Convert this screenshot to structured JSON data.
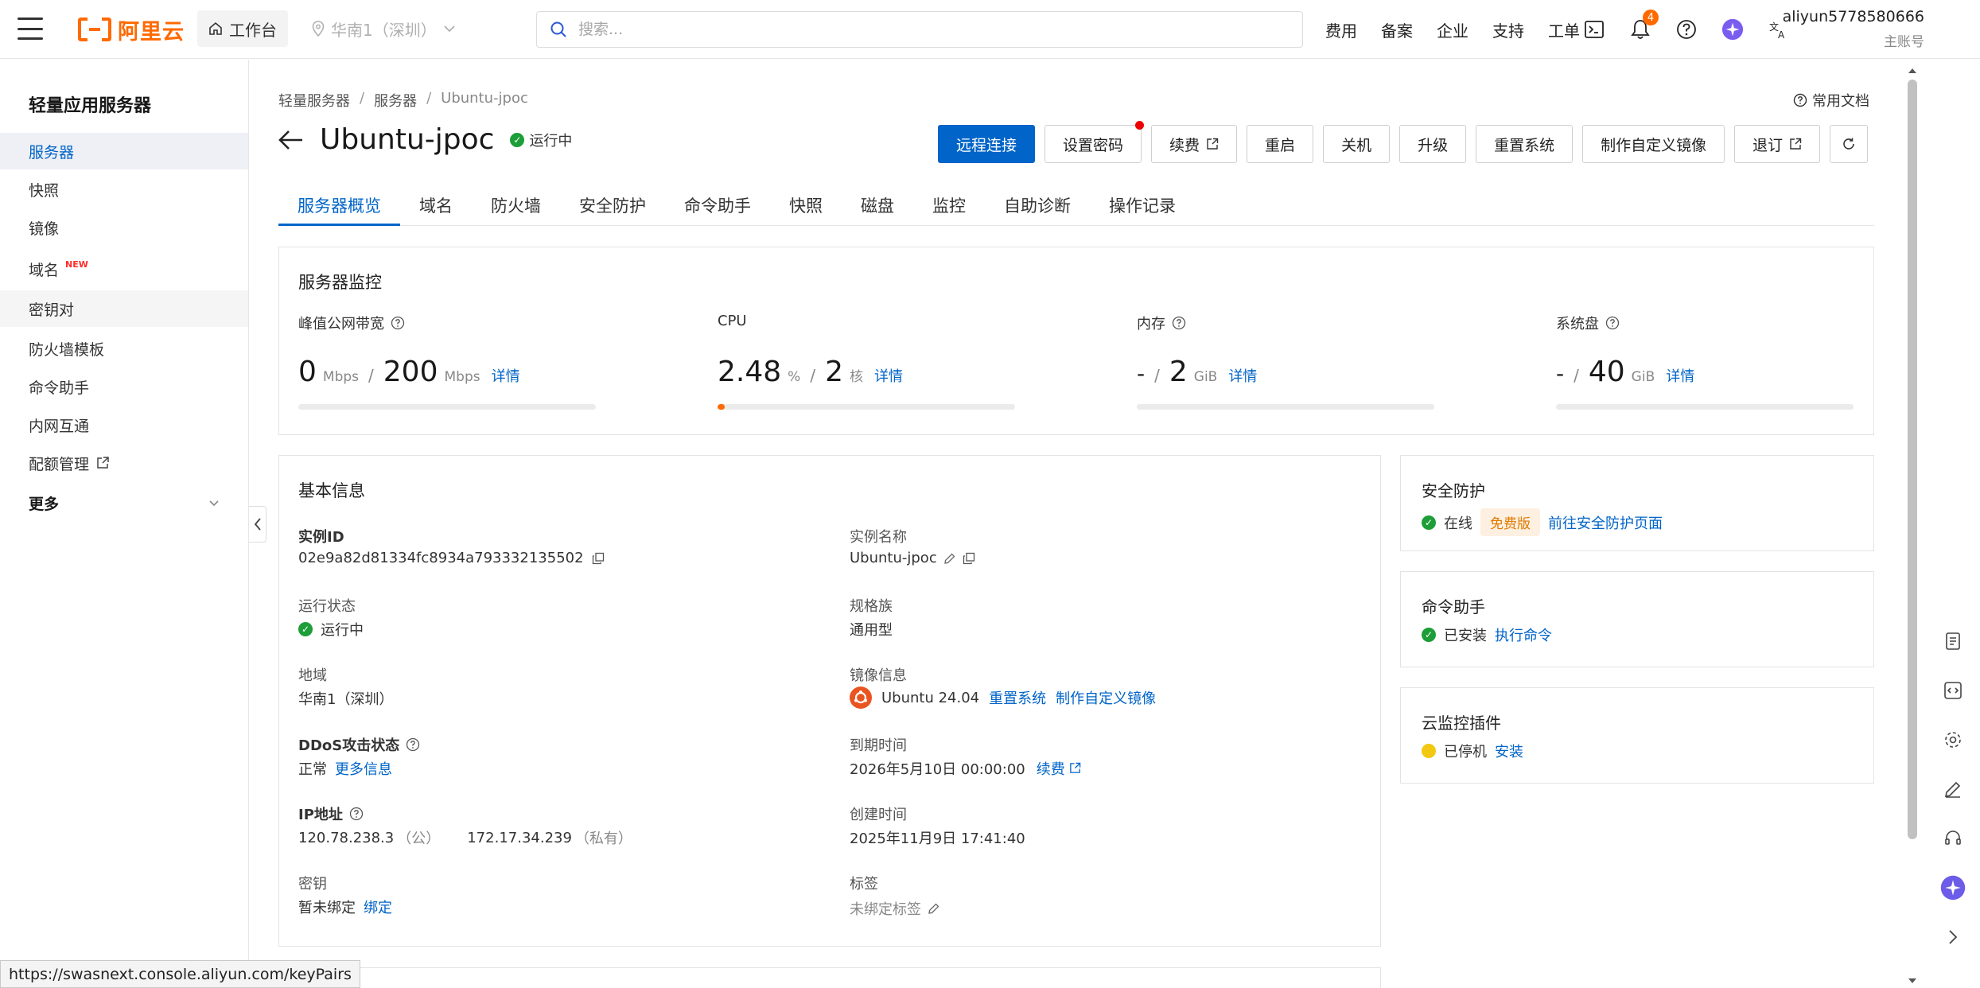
{
  "topbar": {
    "logo_text": "阿里云",
    "workbench": "工作台",
    "region": "华南1（深圳）",
    "search_placeholder": "搜索...",
    "nav": [
      "费用",
      "备案",
      "企业",
      "支持",
      "工单"
    ],
    "notification_count": "4",
    "account_name": "aliyun5778580666",
    "account_role": "主账号"
  },
  "sidebar": {
    "title": "轻量应用服务器",
    "items": [
      {
        "label": "服务器",
        "state": "active"
      },
      {
        "label": "快照"
      },
      {
        "label": "镜像"
      },
      {
        "label": "域名",
        "badge": "NEW"
      },
      {
        "label": "密钥对",
        "state": "hover"
      },
      {
        "label": "防火墙模板"
      },
      {
        "label": "命令助手"
      },
      {
        "label": "内网互通"
      },
      {
        "label": "配额管理"
      },
      {
        "label": "更多"
      }
    ]
  },
  "breadcrumb": [
    "轻量服务器",
    "服务器",
    "Ubuntu-jpoc"
  ],
  "docs_link": "常用文档",
  "header": {
    "title": "Ubuntu-jpoc",
    "status": "运行中"
  },
  "actions": [
    "远程连接",
    "设置密码",
    "续费",
    "重启",
    "关机",
    "升级",
    "重置系统",
    "制作自定义镜像",
    "退订"
  ],
  "tabs": [
    "服务器概览",
    "域名",
    "防火墙",
    "安全防护",
    "命令助手",
    "快照",
    "磁盘",
    "监控",
    "自助诊断",
    "操作记录"
  ],
  "monitor": {
    "title": "服务器监控",
    "bandwidth": {
      "label": "峰值公网带宽",
      "value": "0",
      "unit": "Mbps",
      "total": "200",
      "total_unit": "Mbps",
      "link": "详情",
      "usage": 0
    },
    "cpu": {
      "label": "CPU",
      "value": "2.48",
      "unit": "%",
      "total": "2",
      "total_unit": "核",
      "link": "详情",
      "usage": 0.0248
    },
    "memory": {
      "label": "内存",
      "value": "-",
      "total": "2",
      "total_unit": "GiB",
      "link": "详情",
      "usage": 0
    },
    "disk": {
      "label": "系统盘",
      "value": "-",
      "total": "40",
      "total_unit": "GiB",
      "link": "详情",
      "usage": 0
    }
  },
  "basic": {
    "title": "基本信息",
    "instance_id_label": "实例ID",
    "instance_id": "02e9a82d81334fc8934a793332135502",
    "instance_name_label": "实例名称",
    "instance_name": "Ubuntu-jpoc",
    "run_state_label": "运行状态",
    "run_state": "运行中",
    "spec_label": "规格族",
    "spec": "通用型",
    "region_label": "地域",
    "region": "华南1（深圳）",
    "image_label": "镜像信息",
    "image": "Ubuntu 24.04",
    "image_reset": "重置系统",
    "image_custom": "制作自定义镜像",
    "ddos_label": "DDoS攻击状态",
    "ddos": "正常",
    "ddos_more": "更多信息",
    "expire_label": "到期时间",
    "expire": "2026年5月10日 00:00:00",
    "expire_renew": "续费",
    "ip_label": "IP地址",
    "ip_public": "120.78.238.3",
    "ip_public_tag": "（公）",
    "ip_private": "172.17.34.239",
    "ip_private_tag": "（私有）",
    "created_label": "创建时间",
    "created": "2025年11月9日 17:41:40",
    "key_label": "密钥",
    "key": "暂未绑定",
    "key_bind": "绑定",
    "tag_label": "标签",
    "tag": "未绑定标签"
  },
  "security": {
    "title": "安全防护",
    "status": "在线",
    "tier": "免费版",
    "link": "前往安全防护页面"
  },
  "command": {
    "title": "命令助手",
    "status": "已安装",
    "link": "执行命令"
  },
  "cloudmon": {
    "title": "云监控插件",
    "status": "已停机",
    "link": "安装"
  },
  "status_url": "https://swasnext.console.aliyun.com/keyPairs",
  "colors": {
    "brand": "#ff6a00",
    "primary": "#0064c8",
    "ok": "#1d9e38",
    "warn": "#f2c811"
  }
}
